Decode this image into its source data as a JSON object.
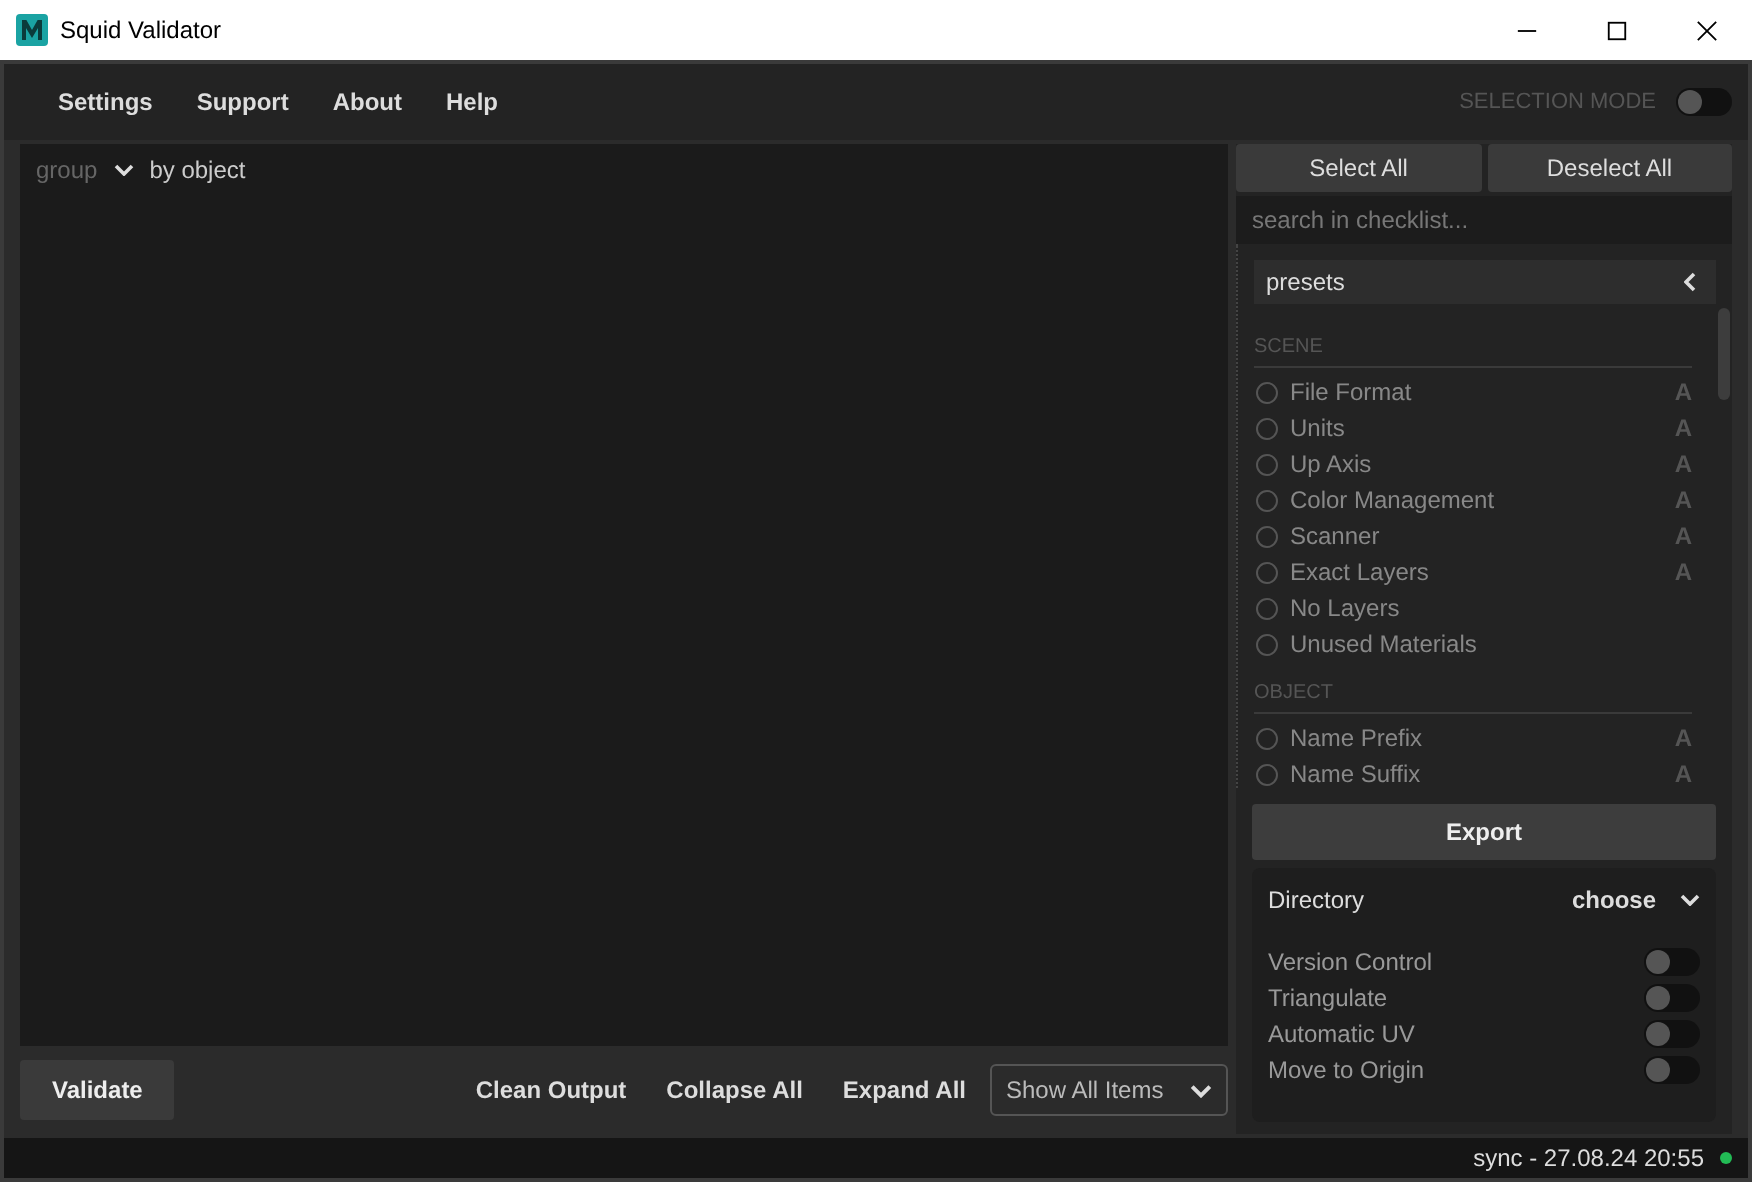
{
  "window": {
    "title": "Squid Validator"
  },
  "menu": [
    "Settings",
    "Support",
    "About",
    "Help"
  ],
  "selection_mode": {
    "label": "SELECTION MODE",
    "on": false
  },
  "output": {
    "group_label": "group",
    "group_value": "by object"
  },
  "checklist": {
    "select_all": "Select All",
    "deselect_all": "Deselect All",
    "search": {
      "placeholder": "search in checklist..."
    },
    "presets": "presets",
    "sections": [
      {
        "title": "SCENE",
        "items": [
          {
            "label": "File Format",
            "checked": false,
            "tag": "A"
          },
          {
            "label": "Units",
            "checked": false,
            "tag": "A"
          },
          {
            "label": "Up Axis",
            "checked": false,
            "tag": "A"
          },
          {
            "label": "Color Management",
            "checked": false,
            "tag": "A"
          },
          {
            "label": "Scanner",
            "checked": false,
            "tag": "A"
          },
          {
            "label": "Exact Layers",
            "checked": false,
            "tag": "A"
          },
          {
            "label": "No Layers",
            "checked": false
          },
          {
            "label": "Unused Materials",
            "checked": false
          }
        ]
      },
      {
        "title": "OBJECT",
        "items": [
          {
            "label": "Name Prefix",
            "checked": false,
            "tag": "A"
          },
          {
            "label": "Name Suffix",
            "checked": false,
            "tag": "A"
          }
        ]
      }
    ]
  },
  "export": {
    "button": "Export",
    "directory_label": "Directory",
    "directory_value": "choose",
    "options": [
      {
        "label": "Version Control",
        "on": false
      },
      {
        "label": "Triangulate",
        "on": false
      },
      {
        "label": "Automatic UV",
        "on": false
      },
      {
        "label": "Move to Origin",
        "on": false
      }
    ]
  },
  "bottom_bar": {
    "validate": "Validate",
    "actions": [
      "Clean Output",
      "Collapse All",
      "Expand All"
    ],
    "filter": "Show All Items"
  },
  "status_bar": {
    "text": "sync - 27.08.24 20:55"
  }
}
